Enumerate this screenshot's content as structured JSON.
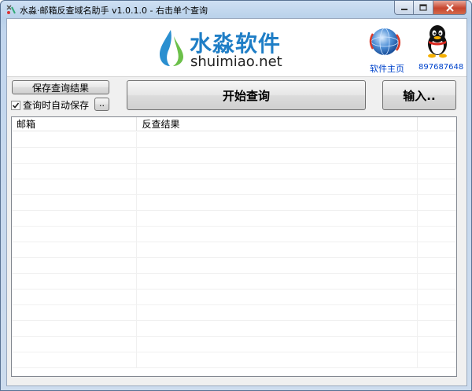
{
  "window": {
    "title": "水淼·邮箱反查域名助手 v1.0.1.0 - 右击单个查询"
  },
  "banner": {
    "logo_cn": "水淼软件",
    "logo_en": "shuimiao.net",
    "homepage_label": "软件主页",
    "qq_label": "897687648"
  },
  "controls": {
    "save_results_label": "保存查询结果",
    "auto_save_label": "查询时自动保存",
    "auto_save_checked": true,
    "browse_label": "..",
    "start_query_label": "开始查询",
    "input_label": "输入.."
  },
  "table": {
    "columns": [
      "邮箱",
      "反查结果",
      ""
    ],
    "rows": []
  },
  "colors": {
    "brand_blue": "#1f7ec6",
    "link_blue": "#0044cc"
  },
  "icons": [
    "app-icon",
    "water-drop-logo-icon",
    "globe-icon",
    "qq-penguin-icon",
    "minimize-icon",
    "maximize-icon",
    "close-icon",
    "checkmark-icon"
  ]
}
